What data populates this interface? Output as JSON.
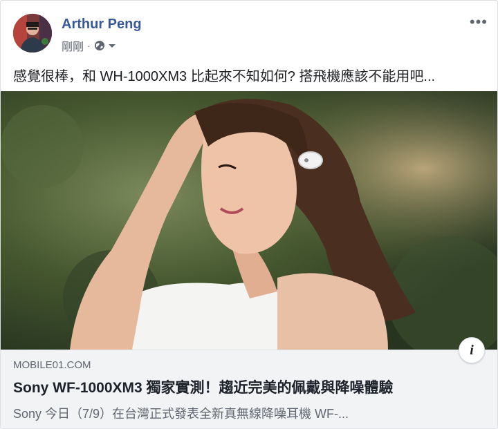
{
  "post": {
    "author": "Arthur Peng",
    "timestamp": "剛剛",
    "separator": "·",
    "audience_icon": "globe-icon",
    "menu_icon": "more-options-icon",
    "text": "感覺很棒，和 WH-1000XM3 比起來不知如何? 搭飛機應該不能用吧..."
  },
  "link_preview": {
    "domain": "MOBILE01.COM",
    "title": "Sony WF-1000XM3 獨家實測！趨近完美的佩戴與降噪體驗",
    "description": "Sony 今日（7/9）在台灣正式發表全新真無線降噪耳機 WF-...",
    "info_label": "i"
  },
  "colors": {
    "author": "#385898",
    "meta": "#606770",
    "link_bg": "#f2f3f5"
  }
}
